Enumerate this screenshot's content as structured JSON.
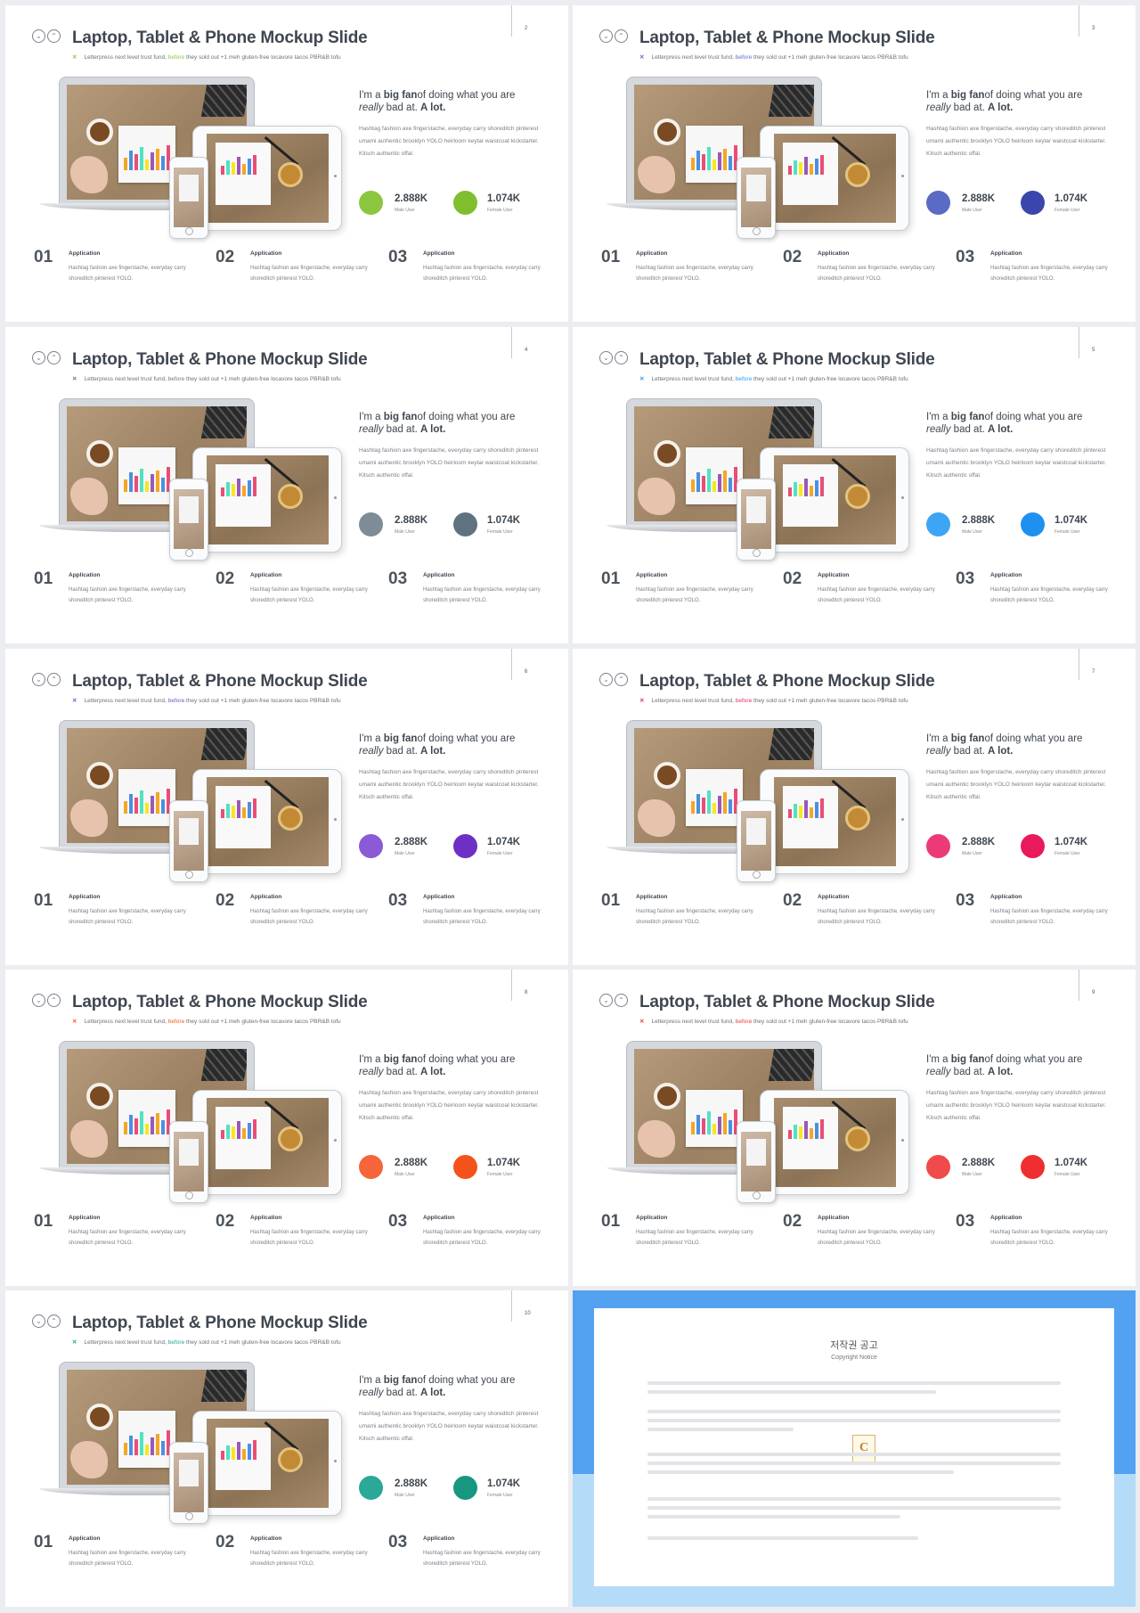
{
  "slides": [
    {
      "page": "2",
      "accent": "#8cc63f",
      "dot1": "#8cc63f",
      "dot2": "#7fbf2e"
    },
    {
      "page": "3",
      "accent": "#5b6fc7",
      "dot1": "#5b6ac4",
      "dot2": "#3b46ad"
    },
    {
      "page": "4",
      "accent": "#6b7b86",
      "dot1": "#7d8c96",
      "dot2": "#5f7280"
    },
    {
      "page": "5",
      "accent": "#2e9bf0",
      "dot1": "#3da5f4",
      "dot2": "#1e90f0"
    },
    {
      "page": "6",
      "accent": "#7c4fd0",
      "dot1": "#8b5ad6",
      "dot2": "#6d2fc4"
    },
    {
      "page": "7",
      "accent": "#e8306a",
      "dot1": "#ec3a78",
      "dot2": "#e91a5c"
    },
    {
      "page": "8",
      "accent": "#f65a2a",
      "dot1": "#f6653a",
      "dot2": "#f3521b"
    },
    {
      "page": "9",
      "accent": "#ef3a3a",
      "dot1": "#f04a4a",
      "dot2": "#ef2f2f"
    },
    {
      "page": "10",
      "accent": "#24a595",
      "dot1": "#2aa898",
      "dot2": "#17977f"
    }
  ],
  "common": {
    "title": "Laptop, Tablet & Phone Mockup Slide",
    "subtitle_x": "✕",
    "subtitle_a": "Letterpress next level trust fund,",
    "subtitle_b": "before",
    "subtitle_c": "they sold out +1 meh gluten-free locavore tacos PBR&B tofu",
    "headline_1": "I'm a ",
    "headline_bold": "big fan",
    "headline_2": "of doing what you are",
    "headline_italic": "really",
    "headline_3": " bad at. ",
    "headline_bold2": "A lot.",
    "description": "Hashtag fashion axe fingerstache, everyday carry shoreditch pinterest umami authentic brooklyn YOLO heirloom keytar waistcoat kickstarter. Kitsch authentic offal.",
    "stat1_value": "2.888K",
    "stat1_label": "Male User",
    "stat2_value": "1.074K",
    "stat2_label": "Female User",
    "features": [
      {
        "num": "01",
        "title": "Application",
        "desc": "Hashtag fashion axe fingerstache, everyday carry shoreditch pinterest YOLO."
      },
      {
        "num": "02",
        "title": "Application",
        "desc": "Hashtag fashion axe fingerstache, everyday carry shoreditch pinterest YOLO."
      },
      {
        "num": "03",
        "title": "Application",
        "desc": "Hashtag fashion axe fingerstache, everyday carry shoreditch pinterest YOLO."
      }
    ],
    "chart_bar_colors": [
      "#f5a623",
      "#4a90e2",
      "#e94e77",
      "#50e3c2",
      "#f8e71c",
      "#9b59b6"
    ]
  },
  "copyright": {
    "title": "저작권 공고",
    "subtitle": "Copyright Notice",
    "logo_letter": "C"
  }
}
